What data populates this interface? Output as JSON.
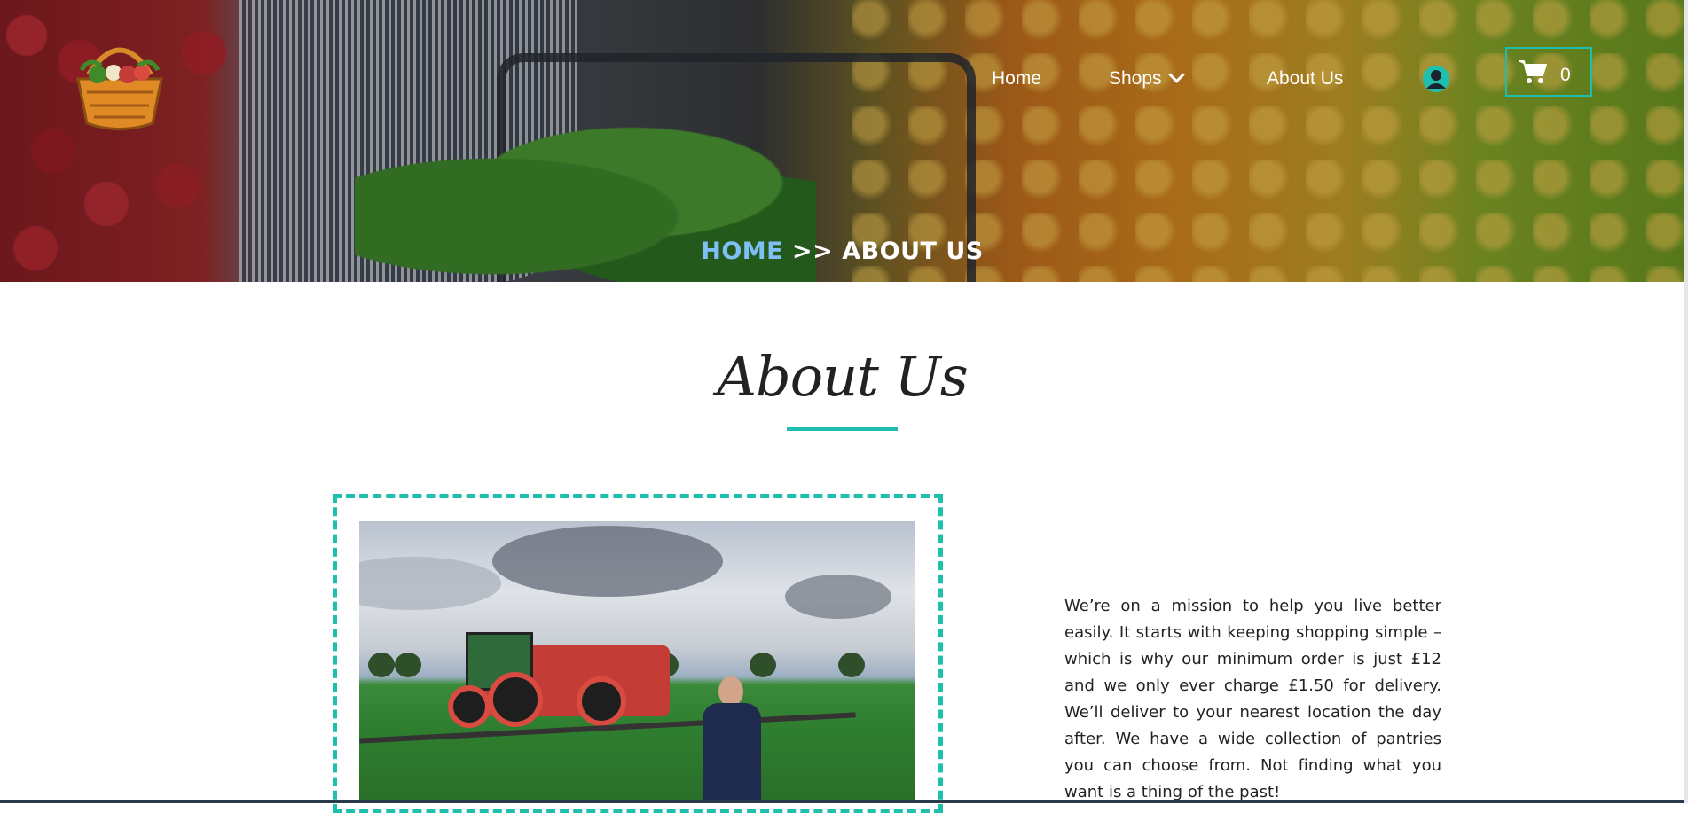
{
  "nav": {
    "home": "Home",
    "shops": "Shops",
    "about": "About Us",
    "cart_count": "0"
  },
  "breadcrumb": {
    "home": "HOME",
    "separator": ">>",
    "current": "ABOUT US"
  },
  "section": {
    "title": "About Us",
    "paragraph": "We’re on a mission to help you live better easily. It starts with keeping shopping simple – which is why our minimum order is just £12 and we only ever charge £1.50 for delivery. We’ll deliver to your nearest location the day after. We have a wide collection of pantries you can choose from. Not finding what you want is a thing of the past!"
  },
  "colors": {
    "accent": "#1fbfae",
    "breadcrumb_home": "#7fbff5"
  },
  "icons": {
    "logo": "basket-logo-icon",
    "user": "user-circle-icon",
    "cart": "shopping-cart-icon",
    "chevron": "chevron-down-icon"
  }
}
